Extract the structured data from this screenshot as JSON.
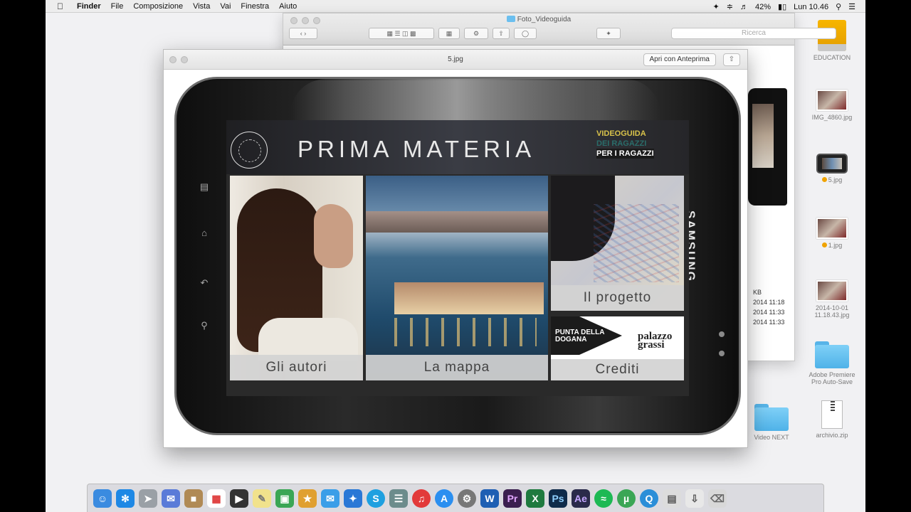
{
  "menubar": {
    "apple": "",
    "menus": [
      "Finder",
      "File",
      "Composizione",
      "Vista",
      "Vai",
      "Finestra",
      "Aiuto"
    ],
    "battery": "42%",
    "clock": "Lun 10.46"
  },
  "finder": {
    "title": "Foto_Videoguida",
    "search_placeholder": "Ricerca",
    "dates": [
      "2014 11:18",
      "2014 11:33",
      "2014 11:33"
    ],
    "size_fragment": "KB"
  },
  "preview": {
    "title": "5.jpg",
    "open_button": "Apri con Anteprima"
  },
  "app": {
    "title": "PRIMA  MATERIA",
    "videoguida_line1": "VIDEOGUIDA",
    "videoguida_line2": "DEI RAGAZZI",
    "videoguida_line3": "PER I RAGAZZI",
    "tiles": {
      "autori": "Gli  autori",
      "mappa": "La  mappa",
      "progetto": "Il  progetto",
      "crediti": "Crediti"
    },
    "punta": "PUNTA DELLA DOGANA",
    "palazzo": "palazzo grassi"
  },
  "tablet": {
    "brand": "SAMSUNG"
  },
  "desktop": {
    "items": [
      {
        "label": "EDUCATION",
        "icon": "drive-icon"
      },
      {
        "label": "IMG_4860.jpg",
        "icon": "photo-icon"
      },
      {
        "label": "5.jpg",
        "icon": "tablet-photo-icon"
      },
      {
        "label": "1.jpg",
        "icon": "photo-icon"
      },
      {
        "label": "2014-10-01 11.18.43.jpg",
        "icon": "photo-icon"
      },
      {
        "label": "Adobe Premiere Pro Auto-Save",
        "icon": "folder-icon"
      },
      {
        "label": "archivio.zip",
        "icon": "zip-icon"
      }
    ],
    "left_folder_label": "Video NEXT"
  },
  "colors": {
    "menubar_bg": "#ededed",
    "desktop_bg": "#f1f1f3",
    "tablet_body": "#1a1a1a",
    "app_header": "#2f3036",
    "caption_bg": "#d2d2d2"
  }
}
